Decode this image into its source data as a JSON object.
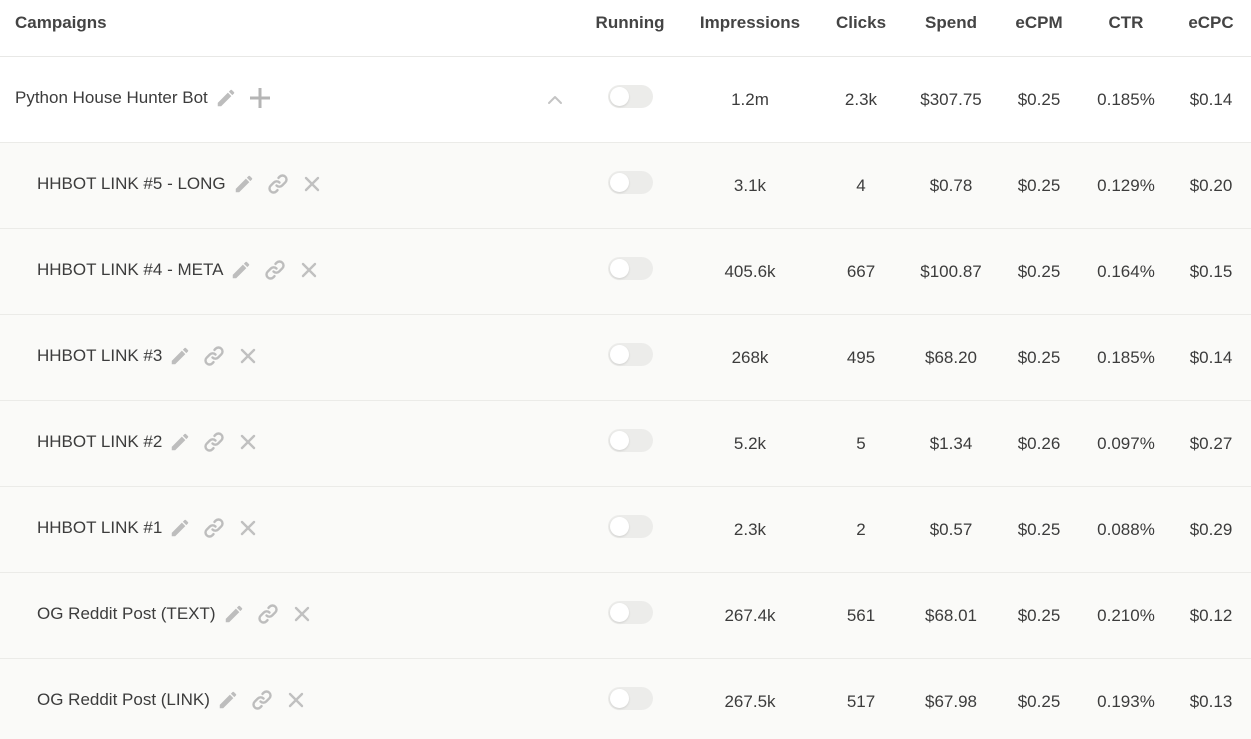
{
  "headers": {
    "campaigns": "Campaigns",
    "running": "Running",
    "impressions": "Impressions",
    "clicks": "Clicks",
    "spend": "Spend",
    "ecpm": "eCPM",
    "ctr": "CTR",
    "ecpc": "eCPC"
  },
  "icons": {
    "edit": "pencil-icon",
    "add": "plus-icon",
    "link": "link-icon",
    "remove": "close-icon",
    "collapse": "chevron-up-icon"
  },
  "colors": {
    "icon": "#bdbdbd",
    "toggle_off": "#ececea",
    "child_row_bg": "#fafaf8"
  },
  "campaign": {
    "name": "Python House Hunter Bot",
    "running": false,
    "impressions": "1.2m",
    "clicks": "2.3k",
    "spend": "$307.75",
    "ecpm": "$0.25",
    "ctr": "0.185%",
    "ecpc": "$0.14"
  },
  "ads": [
    {
      "name": "HHBOT LINK #5 - LONG",
      "running": false,
      "impressions": "3.1k",
      "clicks": "4",
      "spend": "$0.78",
      "ecpm": "$0.25",
      "ctr": "0.129%",
      "ecpc": "$0.20"
    },
    {
      "name": "HHBOT LINK #4 - META",
      "running": false,
      "impressions": "405.6k",
      "clicks": "667",
      "spend": "$100.87",
      "ecpm": "$0.25",
      "ctr": "0.164%",
      "ecpc": "$0.15"
    },
    {
      "name": "HHBOT LINK #3",
      "running": false,
      "impressions": "268k",
      "clicks": "495",
      "spend": "$68.20",
      "ecpm": "$0.25",
      "ctr": "0.185%",
      "ecpc": "$0.14"
    },
    {
      "name": "HHBOT LINK #2",
      "running": false,
      "impressions": "5.2k",
      "clicks": "5",
      "spend": "$1.34",
      "ecpm": "$0.26",
      "ctr": "0.097%",
      "ecpc": "$0.27"
    },
    {
      "name": "HHBOT LINK #1",
      "running": false,
      "impressions": "2.3k",
      "clicks": "2",
      "spend": "$0.57",
      "ecpm": "$0.25",
      "ctr": "0.088%",
      "ecpc": "$0.29"
    },
    {
      "name": "OG Reddit Post (TEXT)",
      "running": false,
      "impressions": "267.4k",
      "clicks": "561",
      "spend": "$68.01",
      "ecpm": "$0.25",
      "ctr": "0.210%",
      "ecpc": "$0.12"
    },
    {
      "name": "OG Reddit Post (LINK)",
      "running": false,
      "impressions": "267.5k",
      "clicks": "517",
      "spend": "$67.98",
      "ecpm": "$0.25",
      "ctr": "0.193%",
      "ecpc": "$0.13"
    }
  ]
}
